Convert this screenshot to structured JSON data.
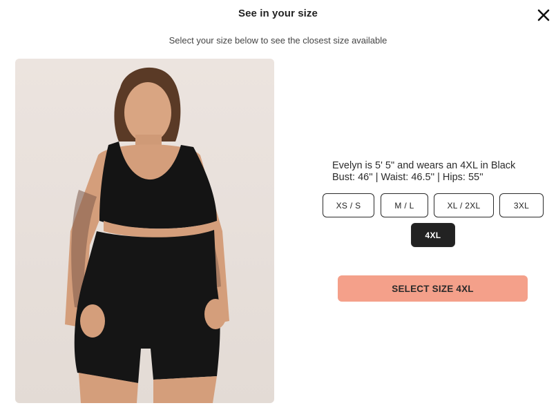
{
  "modal": {
    "title": "See in your size",
    "subtitle": "Select your size below to see the closest size available",
    "close_icon": "close-icon"
  },
  "model_info": {
    "line1": "Evelyn is 5' 5\" and wears an 4XL in Black",
    "line2": "Bust: 46'' | Waist: 46.5'' | Hips: 55''"
  },
  "sizes": {
    "options": [
      "XS / S",
      "M / L",
      "XL / 2XL",
      "3XL",
      "4XL"
    ],
    "selected": "4XL"
  },
  "cta": {
    "label": "SELECT SIZE 4XL",
    "color": "#f4a08a"
  },
  "colors": {
    "selected_bg": "#222222",
    "border": "#2a2a2a"
  }
}
